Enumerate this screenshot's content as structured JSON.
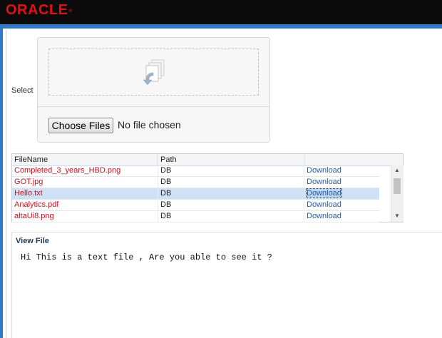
{
  "header": {
    "brand": "ORACLE",
    "brand_mark": "®"
  },
  "upload": {
    "select_label": "Select",
    "choose_button_label": "Choose Files",
    "no_file_text": "No file chosen"
  },
  "grid": {
    "columns": [
      "FileName",
      "Path",
      ""
    ],
    "rows": [
      {
        "name": "Completed_3_years_HBD.png",
        "path": "DB",
        "action": "Download"
      },
      {
        "name": "GOT.jpg",
        "path": "DB",
        "action": "Download"
      },
      {
        "name": "Hello.txt",
        "path": "DB",
        "action": "Download",
        "selected": true
      },
      {
        "name": "Analytics.pdf",
        "path": "DB",
        "action": "Download"
      },
      {
        "name": "altaUi8.png",
        "path": "DB",
        "action": "Download"
      }
    ]
  },
  "viewer": {
    "title": "View File",
    "content": "Hi This is a text file , Are you able to see it ?"
  },
  "colors": {
    "brand_red": "#e30f13",
    "accent_blue": "#2e79c8",
    "filename_red": "#d0101a",
    "link_blue": "#1f5da8",
    "selected_row": "#cfe1f4"
  },
  "icons": {
    "drop_icon": "documents-upload-icon",
    "scroll_up": "triangle-up-icon",
    "scroll_down": "triangle-down-icon"
  }
}
